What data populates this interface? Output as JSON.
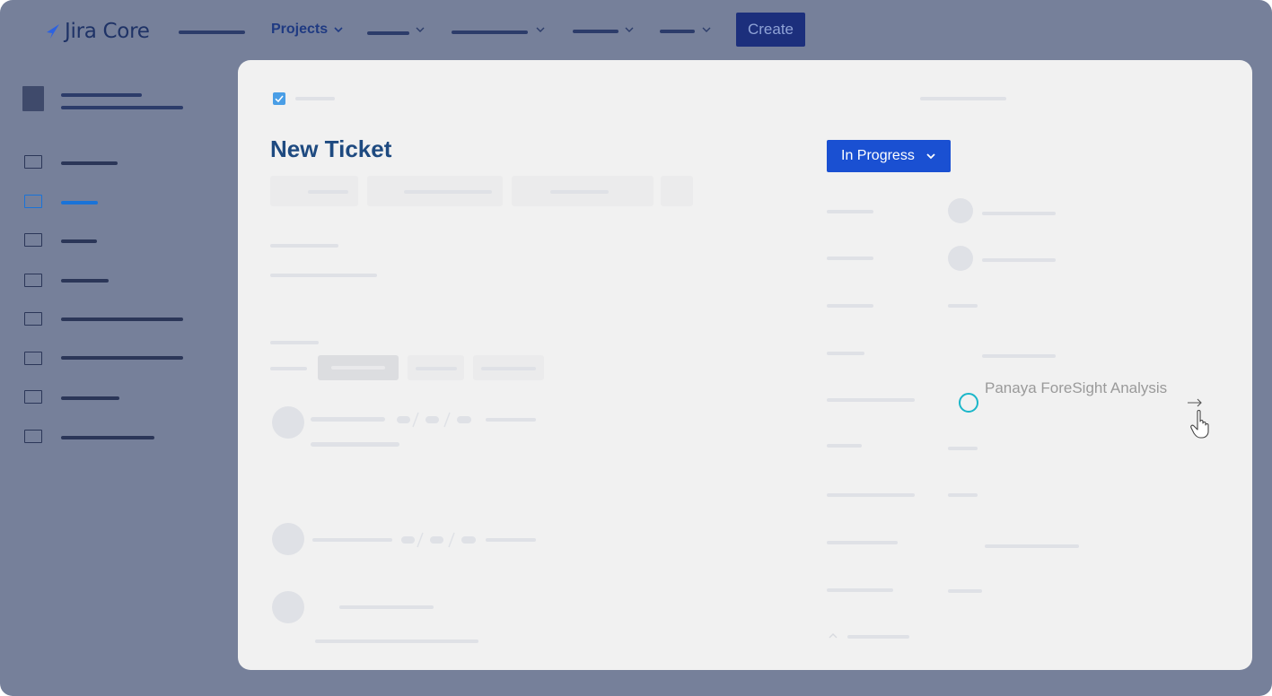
{
  "app": {
    "logo_text": "Jira Core",
    "nav": {
      "projects_label": "Projects"
    },
    "create_label": "Create"
  },
  "ticket": {
    "title": "New Ticket",
    "status": "In Progress"
  },
  "foresight": {
    "label": "Panaya ForeSight Analysis"
  },
  "colors": {
    "frame": "#76809a",
    "panel": "#f1f1f1",
    "primary": "#1a50d2",
    "create_button": "#1c2f7c",
    "sidebar_active": "#1a73d8",
    "foresight_ring": "#1ab6c9"
  },
  "icons": [
    "jira-logo-icon",
    "chevron-down-icon",
    "sidebar-item-icon",
    "checkbox-icon",
    "arrow-right-icon",
    "hand-pointer-icon"
  ]
}
